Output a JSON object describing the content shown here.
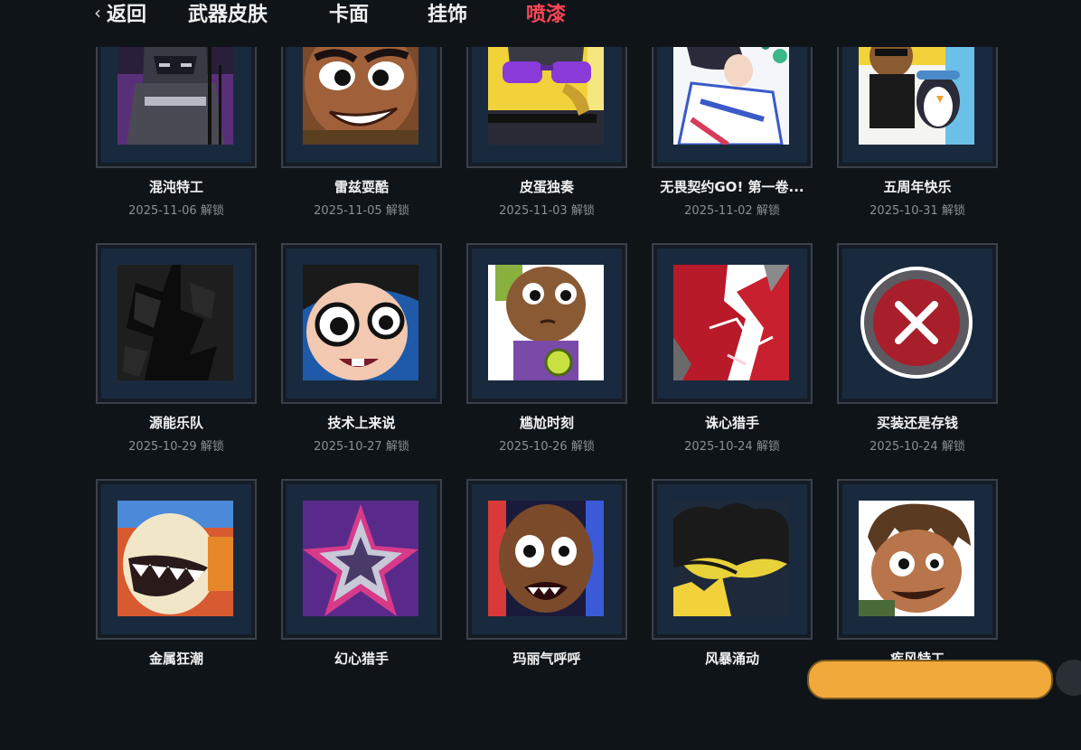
{
  "nav": {
    "back_label": "返回",
    "tabs": [
      {
        "label": "武器皮肤",
        "active": false
      },
      {
        "label": "卡面",
        "active": false
      },
      {
        "label": "挂饰",
        "active": false
      },
      {
        "label": "喷漆",
        "active": true
      }
    ],
    "active_color": "#ff4655"
  },
  "unlock_suffix": "解锁",
  "sprays": [
    {
      "name": "混沌特工",
      "date": "2025-11-06 解锁"
    },
    {
      "name": "雷兹耍酷",
      "date": "2025-11-05 解锁"
    },
    {
      "name": "皮蛋独奏",
      "date": "2025-11-03 解锁"
    },
    {
      "name": "无畏契约GO! 第一卷...",
      "date": "2025-11-02 解锁"
    },
    {
      "name": "五周年快乐",
      "date": "2025-10-31 解锁"
    },
    {
      "name": "源能乐队",
      "date": "2025-10-29 解锁"
    },
    {
      "name": "技术上来说",
      "date": "2025-10-27 解锁"
    },
    {
      "name": "尴尬时刻",
      "date": "2025-10-26 解锁"
    },
    {
      "name": "诛心猎手",
      "date": "2025-10-24 解锁"
    },
    {
      "name": "买装还是存钱",
      "date": "2025-10-24 解锁"
    },
    {
      "name": "金属狂潮",
      "date": ""
    },
    {
      "name": "幻心猎手",
      "date": ""
    },
    {
      "name": "玛丽气呼呼",
      "date": ""
    },
    {
      "name": "风暴涌动",
      "date": ""
    },
    {
      "name": "疾风特工",
      "date": ""
    }
  ]
}
